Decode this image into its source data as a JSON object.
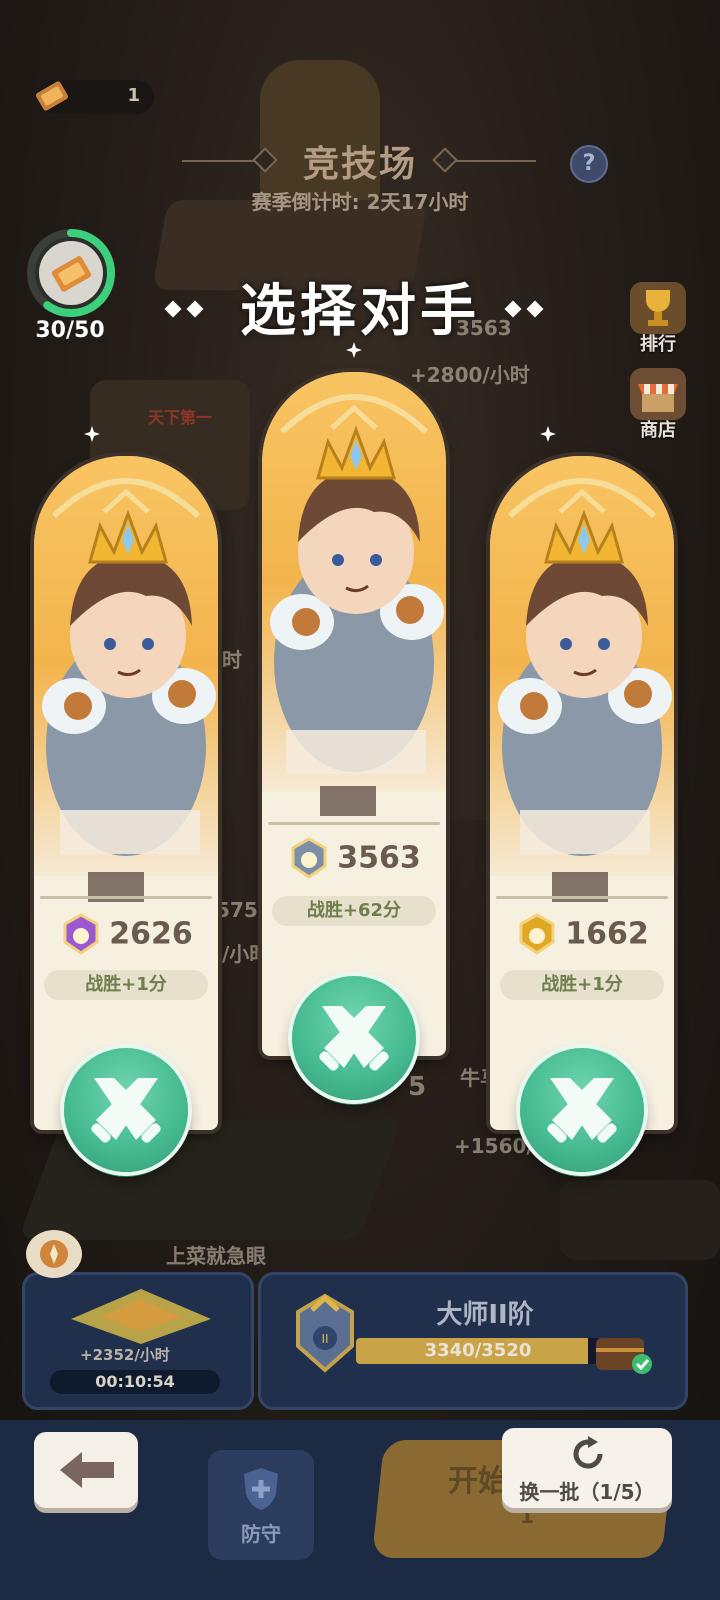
{
  "top": {
    "ticket_count": "1",
    "arena_title": "竞技场",
    "season_countdown": "赛季倒计时: 2天17小时",
    "energy_text": "30/50",
    "energy_fraction": 0.6,
    "help_icon": "question-icon"
  },
  "dialog": {
    "title": "选择对手"
  },
  "side_menu": [
    {
      "label": "排行",
      "icon": "trophy-icon"
    },
    {
      "label": "商店",
      "icon": "shop-icon"
    }
  ],
  "background_text": {
    "rank_first": "天下第一",
    "top_score": "3563",
    "top_rate": "+2800/小时",
    "mid_rate": "+1560/",
    "bottom_name": "上菜就急眼",
    "bottom_num": "5",
    "side_num": "575",
    "hour_a": "时",
    "hour_b": "/小时",
    "mid_name": "牛马"
  },
  "opponents": [
    {
      "score": "2626",
      "reward": "战胜+1分",
      "badge": "purple-rank-badge-icon",
      "badge_color": "#9b59d0"
    },
    {
      "score": "3563",
      "reward": "战胜+62分",
      "badge": "silver-rank-badge-icon",
      "badge_color": "#7b8fa8"
    },
    {
      "score": "1662",
      "reward": "战胜+1分",
      "badge": "gold-rank-badge-icon",
      "badge_color": "#e0a825"
    }
  ],
  "mine": {
    "rate": "+2352/小时",
    "timer": "00:10:54"
  },
  "rank": {
    "name": "大师II阶",
    "progress_text": "3340/3520",
    "progress_fraction": 0.949
  },
  "bottom": {
    "defense_label": "防守",
    "start_label": "开始",
    "start_cost": "1",
    "refresh_label": "换一批（1/5）"
  },
  "colors": {
    "accent_green": "#44b98f",
    "card_bg": "#f6f0e1",
    "panel_navy": "#1f2f4c"
  }
}
